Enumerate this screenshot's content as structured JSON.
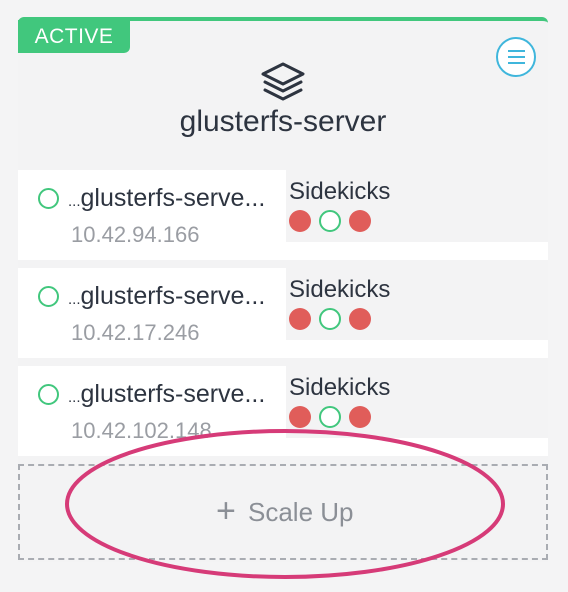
{
  "service": {
    "state": "ACTIVE",
    "name": "glusterfs-server",
    "icon": "stack-layers-icon",
    "menu_icon": "hamburger-menu-icon"
  },
  "containers": [
    {
      "prefix": "...",
      "name": "glusterfs-serve...",
      "ip": "10.42.94.166",
      "status": "running",
      "sidekicks_label": "Sidekicks",
      "sidekicks": [
        "stopped",
        "running",
        "stopped"
      ]
    },
    {
      "prefix": "...",
      "name": "glusterfs-serve...",
      "ip": "10.42.17.246",
      "status": "running",
      "sidekicks_label": "Sidekicks",
      "sidekicks": [
        "stopped",
        "running",
        "stopped"
      ]
    },
    {
      "prefix": "...",
      "name": "glusterfs-serve...",
      "ip": "10.42.102.148",
      "status": "running",
      "sidekicks_label": "Sidekicks",
      "sidekicks": [
        "stopped",
        "running",
        "stopped"
      ]
    }
  ],
  "scale_up": {
    "icon": "+",
    "label": "Scale Up"
  },
  "colors": {
    "active": "#41c77d",
    "stopped": "#e05d5a",
    "accent": "#3fb6dc",
    "annotation": "#d63b78"
  }
}
